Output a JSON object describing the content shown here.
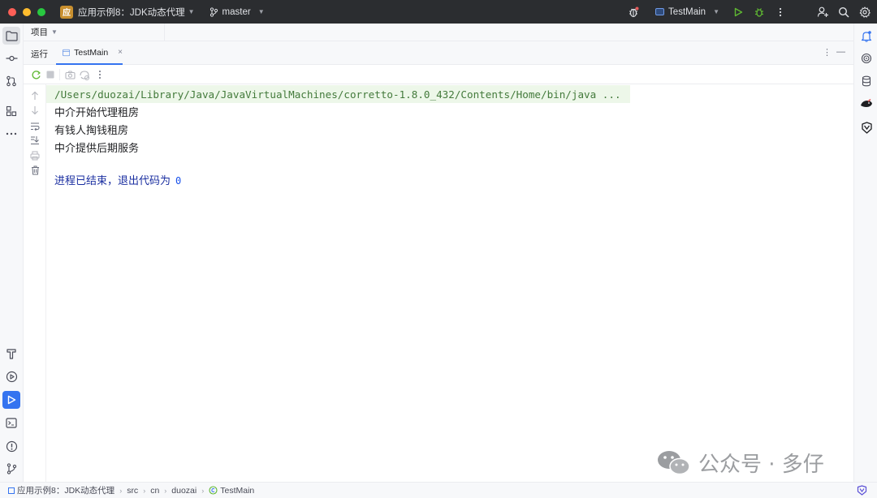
{
  "titlebar": {
    "project_badge": "应",
    "project_name": "应用示例8：JDK动态代理",
    "branch": "master",
    "run_config": "TestMain"
  },
  "project_panel": {
    "label": "项目"
  },
  "run_panel": {
    "label": "运行",
    "tab_name": "TestMain",
    "tab_close": "×"
  },
  "console": {
    "command": "/Users/duozai/Library/Java/JavaVirtualMachines/corretto-1.8.0_432/Contents/Home/bin/java ...",
    "lines": [
      "中介开始代理租房",
      "有钱人掏钱租房",
      "中介提供后期服务"
    ],
    "exit_text": "进程已结束，退出代码为",
    "exit_code": "0"
  },
  "watermark": {
    "text": "公众号 · 多仔"
  },
  "statusbar": {
    "breadcrumbs": [
      "应用示例8：JDK动态代理",
      "src",
      "cn",
      "duozai",
      "TestMain"
    ]
  },
  "colors": {
    "accent": "#3574f0",
    "titlebar_bg": "#2b2d30",
    "command_bg": "#edf7e9",
    "command_text": "#437a3b",
    "exit_text": "#1a2ea0",
    "run_green": "#5fb832"
  }
}
